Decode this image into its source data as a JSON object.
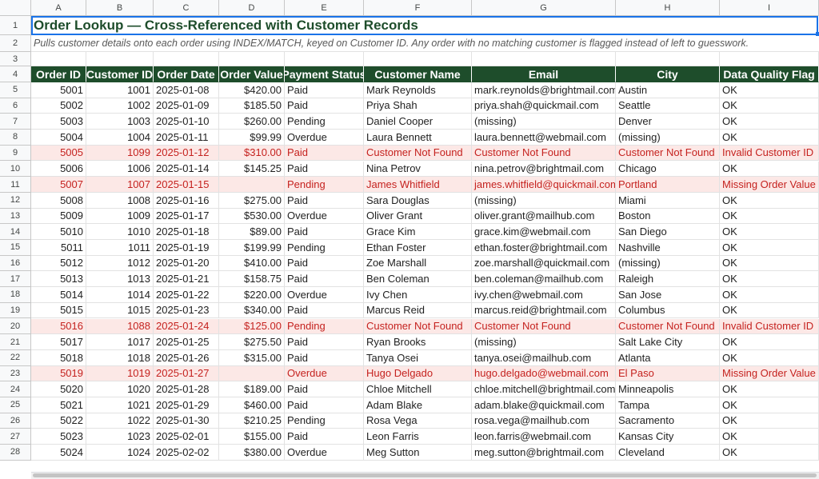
{
  "columns": [
    "A",
    "B",
    "C",
    "D",
    "E",
    "F",
    "G",
    "H",
    "I"
  ],
  "row_numbers": [
    "1",
    "2",
    "3",
    "4",
    "5",
    "6",
    "7",
    "8",
    "9",
    "10",
    "11",
    "12",
    "13",
    "14",
    "15",
    "16",
    "17",
    "18",
    "19",
    "20",
    "21",
    "22",
    "23",
    "24",
    "25",
    "26",
    "27",
    "28"
  ],
  "title": "Order Lookup — Cross-Referenced with Customer Records",
  "subtitle": "Pulls customer details onto each order using INDEX/MATCH, keyed on Customer ID. Any order with no matching customer is flagged instead of left to guesswork.",
  "headers": [
    "Order ID",
    "Customer ID",
    "Order Date",
    "Order Value",
    "Payment Status",
    "Customer Name",
    "Email",
    "City",
    "Data Quality Flag"
  ],
  "colors": {
    "header_bg": "#1e4d2b",
    "error_bg": "#fce8e6",
    "error_text": "#c5221f"
  },
  "rows": [
    {
      "cells": [
        "5001",
        "1001",
        "2025-01-08",
        "$420.00",
        "Paid",
        "Mark Reynolds",
        "mark.reynolds@brightmail.com",
        "Austin",
        "OK"
      ],
      "flag": false
    },
    {
      "cells": [
        "5002",
        "1002",
        "2025-01-09",
        "$185.50",
        "Paid",
        "Priya Shah",
        "priya.shah@quickmail.com",
        "Seattle",
        "OK"
      ],
      "flag": false
    },
    {
      "cells": [
        "5003",
        "1003",
        "2025-01-10",
        "$260.00",
        "Pending",
        "Daniel Cooper",
        "(missing)",
        "Denver",
        "OK"
      ],
      "flag": false
    },
    {
      "cells": [
        "5004",
        "1004",
        "2025-01-11",
        "$99.99",
        "Overdue",
        "Laura Bennett",
        "laura.bennett@webmail.com",
        "(missing)",
        "OK"
      ],
      "flag": false
    },
    {
      "cells": [
        "5005",
        "1099",
        "2025-01-12",
        "$310.00",
        "Paid",
        "Customer Not Found",
        "Customer Not Found",
        "Customer Not Found",
        "Invalid Customer ID"
      ],
      "flag": true
    },
    {
      "cells": [
        "5006",
        "1006",
        "2025-01-14",
        "$145.25",
        "Paid",
        "Nina Petrov",
        "nina.petrov@brightmail.com",
        "Chicago",
        "OK"
      ],
      "flag": false
    },
    {
      "cells": [
        "5007",
        "1007",
        "2025-01-15",
        "",
        "Pending",
        "James Whitfield",
        "james.whitfield@quickmail.com",
        "Portland",
        "Missing Order Value"
      ],
      "flag": true
    },
    {
      "cells": [
        "5008",
        "1008",
        "2025-01-16",
        "$275.00",
        "Paid",
        "Sara Douglas",
        "(missing)",
        "Miami",
        "OK"
      ],
      "flag": false
    },
    {
      "cells": [
        "5009",
        "1009",
        "2025-01-17",
        "$530.00",
        "Overdue",
        "Oliver Grant",
        "oliver.grant@mailhub.com",
        "Boston",
        "OK"
      ],
      "flag": false
    },
    {
      "cells": [
        "5010",
        "1010",
        "2025-01-18",
        "$89.00",
        "Paid",
        "Grace Kim",
        "grace.kim@webmail.com",
        "San Diego",
        "OK"
      ],
      "flag": false
    },
    {
      "cells": [
        "5011",
        "1011",
        "2025-01-19",
        "$199.99",
        "Pending",
        "Ethan Foster",
        "ethan.foster@brightmail.com",
        "Nashville",
        "OK"
      ],
      "flag": false
    },
    {
      "cells": [
        "5012",
        "1012",
        "2025-01-20",
        "$410.00",
        "Paid",
        "Zoe Marshall",
        "zoe.marshall@quickmail.com",
        "(missing)",
        "OK"
      ],
      "flag": false
    },
    {
      "cells": [
        "5013",
        "1013",
        "2025-01-21",
        "$158.75",
        "Paid",
        "Ben Coleman",
        "ben.coleman@mailhub.com",
        "Raleigh",
        "OK"
      ],
      "flag": false
    },
    {
      "cells": [
        "5014",
        "1014",
        "2025-01-22",
        "$220.00",
        "Overdue",
        "Ivy Chen",
        "ivy.chen@webmail.com",
        "San Jose",
        "OK"
      ],
      "flag": false
    },
    {
      "cells": [
        "5015",
        "1015",
        "2025-01-23",
        "$340.00",
        "Paid",
        "Marcus Reid",
        "marcus.reid@brightmail.com",
        "Columbus",
        "OK"
      ],
      "flag": false
    },
    {
      "cells": [
        "5016",
        "1088",
        "2025-01-24",
        "$125.00",
        "Pending",
        "Customer Not Found",
        "Customer Not Found",
        "Customer Not Found",
        "Invalid Customer ID"
      ],
      "flag": true
    },
    {
      "cells": [
        "5017",
        "1017",
        "2025-01-25",
        "$275.50",
        "Paid",
        "Ryan Brooks",
        "(missing)",
        "Salt Lake City",
        "OK"
      ],
      "flag": false
    },
    {
      "cells": [
        "5018",
        "1018",
        "2025-01-26",
        "$315.00",
        "Paid",
        "Tanya Osei",
        "tanya.osei@mailhub.com",
        "Atlanta",
        "OK"
      ],
      "flag": false
    },
    {
      "cells": [
        "5019",
        "1019",
        "2025-01-27",
        "",
        "Overdue",
        "Hugo Delgado",
        "hugo.delgado@webmail.com",
        "El Paso",
        "Missing Order Value"
      ],
      "flag": true
    },
    {
      "cells": [
        "5020",
        "1020",
        "2025-01-28",
        "$189.00",
        "Paid",
        "Chloe Mitchell",
        "chloe.mitchell@brightmail.com",
        "Minneapolis",
        "OK"
      ],
      "flag": false
    },
    {
      "cells": [
        "5021",
        "1021",
        "2025-01-29",
        "$460.00",
        "Paid",
        "Adam Blake",
        "adam.blake@quickmail.com",
        "Tampa",
        "OK"
      ],
      "flag": false
    },
    {
      "cells": [
        "5022",
        "1022",
        "2025-01-30",
        "$210.25",
        "Pending",
        "Rosa Vega",
        "rosa.vega@mailhub.com",
        "Sacramento",
        "OK"
      ],
      "flag": false
    },
    {
      "cells": [
        "5023",
        "1023",
        "2025-02-01",
        "$155.00",
        "Paid",
        "Leon Farris",
        "leon.farris@webmail.com",
        "Kansas City",
        "OK"
      ],
      "flag": false
    },
    {
      "cells": [
        "5024",
        "1024",
        "2025-02-02",
        "$380.00",
        "Overdue",
        "Meg Sutton",
        "meg.sutton@brightmail.com",
        "Cleveland",
        "OK"
      ],
      "flag": false
    }
  ]
}
